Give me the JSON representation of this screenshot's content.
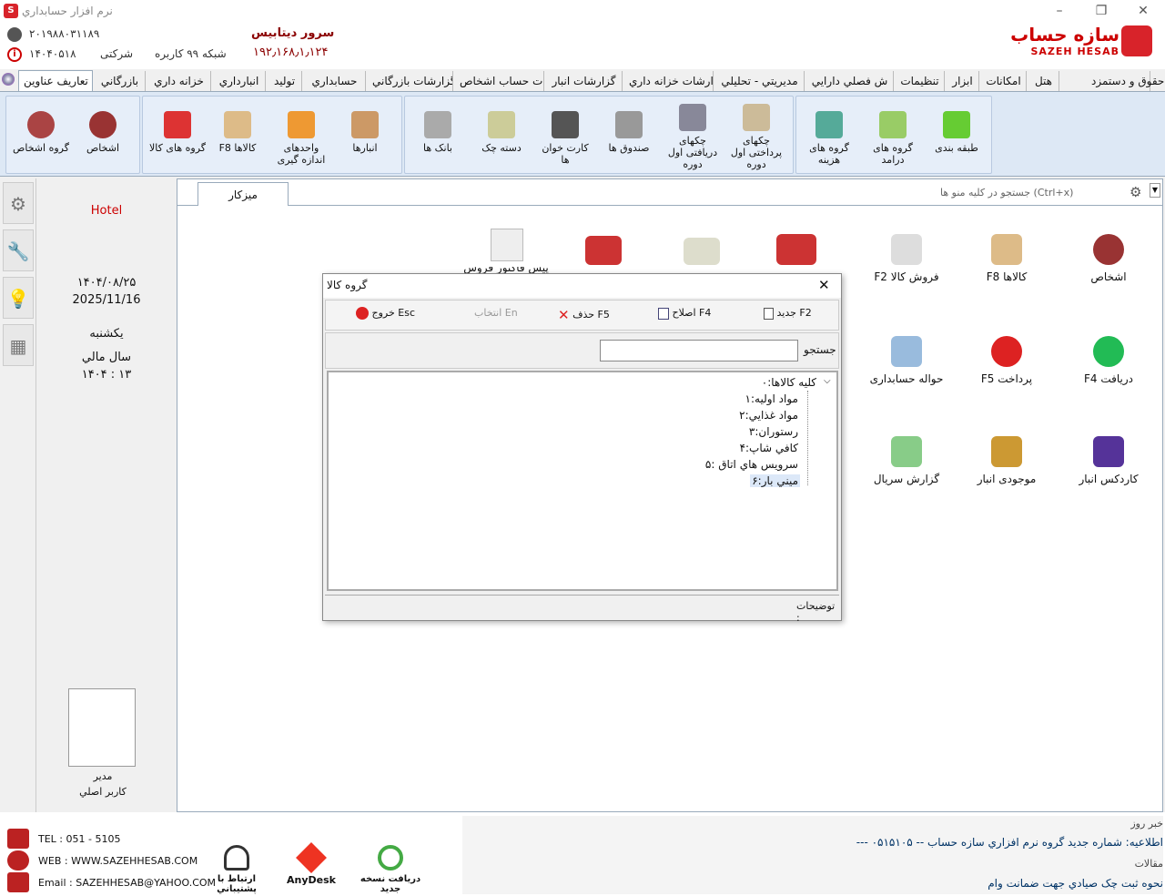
{
  "window": {
    "title": "نرم افزار حسابداري",
    "app_icon": "S"
  },
  "header": {
    "phone": "۲۰۱۹۸۸۰۳۱۱۸۹",
    "server_label": "سرور ديتابيس",
    "license_no": "۱۴۰۴۰۵۱۸",
    "network_label": "شبکه ۹۹ کاربره",
    "company_label": "شرکتی",
    "ip": "۱۹۲٫۱۶۸٫۱٫۱۲۴",
    "brand_fa": "سازه حساب",
    "brand_en": "SAZEH HESAB"
  },
  "tabs": [
    "حقوق و دستمزد",
    "هتل",
    "امکانات",
    "ابزار",
    "تنظيمات",
    "ش فصلي دارايي",
    "مديريتي - تحليلي",
    "ارشات خزانه داري",
    "گزارشات انبار",
    "ت حساب اشخاص",
    "گزارشات بازرگاني",
    "حسابداري",
    "توليد",
    "انبارداري",
    "خزانه داري",
    "بازرگاني",
    "تعاريف عناوين"
  ],
  "ribbon": {
    "g1": [
      {
        "l1": "طبقه بندی",
        "l2": ""
      },
      {
        "l1": "گروه های",
        "l2": "درامد"
      },
      {
        "l1": "گروه های",
        "l2": "هزينه"
      }
    ],
    "g2": [
      {
        "l1": "چکهای",
        "l2": "پرداختی اول",
        "l3": "دوره"
      },
      {
        "l1": "چکهای",
        "l2": "دریافتی اول",
        "l3": "دوره"
      },
      {
        "l1": "صندوق ها",
        "l2": ""
      },
      {
        "l1": "کارت خوان ها",
        "l2": ""
      },
      {
        "l1": "دسته چک",
        "l2": ""
      },
      {
        "l1": "بانک ها",
        "l2": ""
      }
    ],
    "g3": [
      {
        "l1": "انبارها",
        "l2": ""
      },
      {
        "l1": "واحدهای",
        "l2": "اندازه گيری"
      },
      {
        "l1": "F8  کالاها",
        "l2": ""
      },
      {
        "l1": "گروه های کالا",
        "l2": ""
      }
    ],
    "g4": [
      {
        "l1": "اشخاص",
        "l2": ""
      },
      {
        "l1": "گروه اشخاص",
        "l2": ""
      }
    ]
  },
  "workspace": {
    "tab": "ميزکار",
    "search_placeholder": "جستجو در کليه منو ها  (Ctrl+x)",
    "items": [
      {
        "label": "اشخاص"
      },
      {
        "label": "F8  کالاها"
      },
      {
        "label": "F2  فروش کالا"
      },
      {
        "label": "F4  دریافت"
      },
      {
        "label": "F5  پرداخت"
      },
      {
        "label": "حواله حسابداری"
      },
      {
        "label": "کاردکس انبار"
      },
      {
        "label": "موجودی انبار"
      },
      {
        "label": "گزارش سريال"
      }
    ],
    "partial_item": "پيش فاکتور فروش"
  },
  "info": {
    "hotel": "Hotel",
    "date_fa": "۱۴۰۴/۰۸/۲۵",
    "date_en": "2025/11/16",
    "weekday": "يکشنبه",
    "fiscal_label": "سال مالي",
    "fiscal_value": "۱۴۰۴ : ۱۳",
    "user_role": "مدير",
    "user_name": "کاربر اصلي"
  },
  "dialog": {
    "title": "گروه کالا",
    "btn_new": "جديد  F2",
    "btn_edit": "اصلاح F4",
    "btn_delete": "حذف   F5",
    "btn_select": "انتخاب  En",
    "btn_exit": "خروج Esc",
    "search_label": "جستجو",
    "search_value": "",
    "notes_label": "توضيحات :",
    "tree_root": "کليه کالاها:۰",
    "tree": [
      "مواد اوليه:۱",
      "مواد غذايي:۲",
      "رستوران:۳",
      "کافي شاپ:۴",
      "سرويس هاي اتاق :۵",
      "ميني بار:۶"
    ]
  },
  "footer": {
    "tel": "TEL : 051 - 5105",
    "web": "WEB : WWW.SAZEHHESAB.COM",
    "email": "Email : SAZEHHESAB@YAHOO.COM",
    "support": "ارتباط با پشتيباني",
    "anydesk": "AnyDesk",
    "update": "دریافت نسخه جدید",
    "news_label": "خبر روز",
    "news_text": "اطلاعيه: شماره جديد گروه نرم افزاري سازه حساب -- ۰۵۱۵۱۰۵ ---",
    "articles_label": "مقالات",
    "article_text": "نحوه ثبت چک صيادي جهت ضمانت وام"
  }
}
